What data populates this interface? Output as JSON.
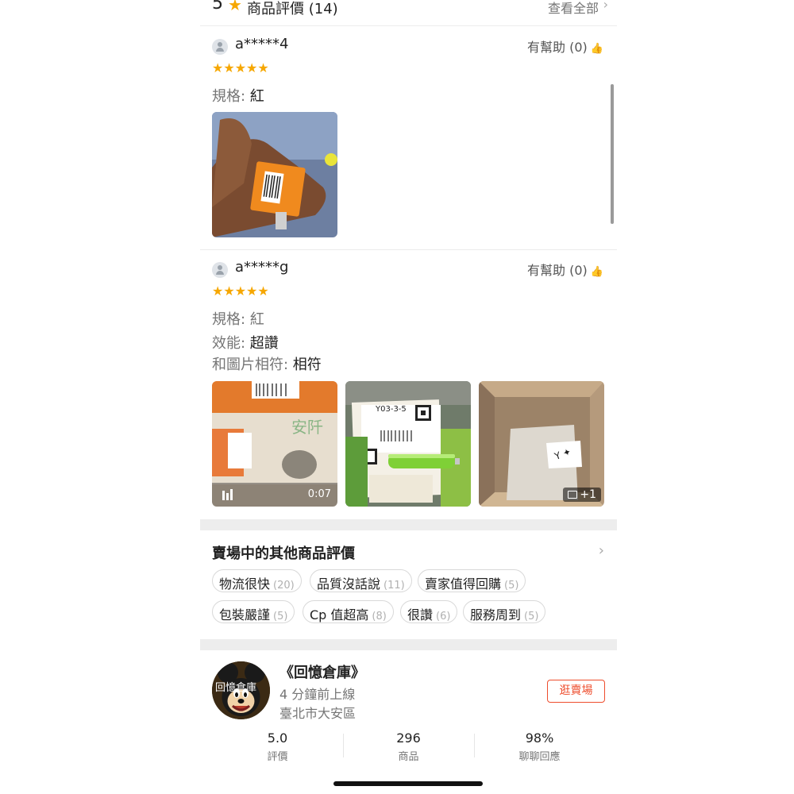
{
  "header": {
    "score": "5",
    "star_icon": "star-icon",
    "title": "商品評價 (14)",
    "view_all": "查看全部",
    "chevron": "›"
  },
  "reviews": [
    {
      "username": "a*****4",
      "helpful": "有幫助 (0)",
      "stars": "★★★★★",
      "rating": 5,
      "specs": [
        {
          "label": "規格: ",
          "value": "紅"
        }
      ]
    },
    {
      "username": "a*****g",
      "helpful": "有幫助 (0)",
      "stars": "★★★★★",
      "rating": 5,
      "specs": [
        {
          "label": "規格: ",
          "value": "紅"
        },
        {
          "label": "效能: ",
          "value": "超讚"
        },
        {
          "label": "和圖片相符: ",
          "value": "相符"
        }
      ],
      "video_duration": "0:07",
      "more_photos": "+1"
    }
  ],
  "other_reviews": {
    "title": "賣場中的其他商品評價",
    "chevron": "›",
    "chips": [
      {
        "label": "物流很快",
        "count": "(20)"
      },
      {
        "label": "品質沒話說",
        "count": "(11)"
      },
      {
        "label": "賣家值得回購",
        "count": "(5)"
      },
      {
        "label": "包裝嚴謹",
        "count": "(5)"
      },
      {
        "label": "Cp 值超高",
        "count": "(8)"
      },
      {
        "label": "很讚",
        "count": "(6)"
      },
      {
        "label": "服務周到",
        "count": "(5)"
      }
    ]
  },
  "shop": {
    "name": "《回憶倉庫》",
    "online": "4 分鐘前上線",
    "location": "臺北市大安區",
    "visit_button": "逛賣場",
    "avatar_text": "回憶倉庫",
    "stats": [
      {
        "value": "5.0",
        "label": "評價"
      },
      {
        "value": "296",
        "label": "商品"
      },
      {
        "value": "98%",
        "label": "聊聊回應"
      }
    ]
  },
  "colors": {
    "star": "#f6a700",
    "accent": "#ee4d2d"
  }
}
